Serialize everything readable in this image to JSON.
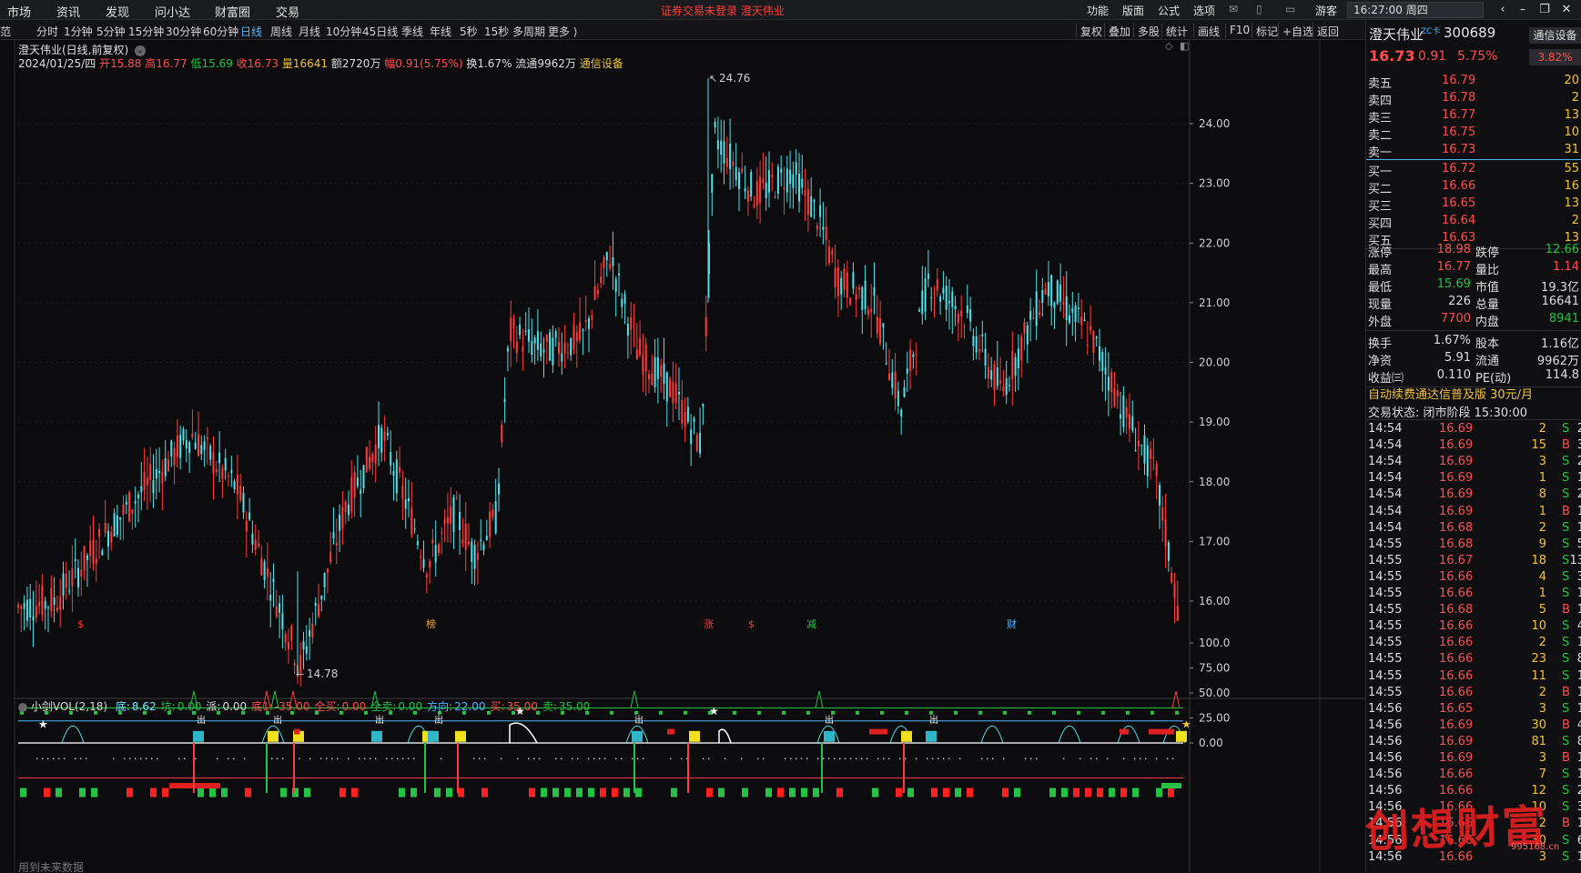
{
  "topbar": {
    "left_menu": [
      "市场",
      "资讯",
      "发现",
      "问小达",
      "财富圈",
      "交易"
    ],
    "warning": "证券交易未登录   澄天伟业",
    "right_menu": [
      "功能",
      "版面",
      "公式",
      "选项"
    ],
    "user": "游客",
    "clock": "16:27:00 周四"
  },
  "periodbar": {
    "cut_label": "范",
    "periods": [
      "分时",
      "1分钟",
      "5分钟",
      "15分钟",
      "30分钟",
      "60分钟",
      "日线",
      "周线",
      "月线",
      "10分钟",
      "45日线",
      "季线",
      "年线",
      "5秒",
      "15秒",
      "多周期",
      "更多 ⟩"
    ],
    "active": "日线",
    "tools": [
      "复权",
      "叠加",
      "多股",
      "统计",
      "画线",
      "F10",
      "标记",
      "+自选",
      "返回"
    ]
  },
  "chart_header": {
    "title": "澄天伟业(日线,前复权)",
    "date": "2024/01/25/四",
    "open_label": "开",
    "open": "15.88",
    "high_label": "高",
    "high": "16.77",
    "low_label": "低",
    "low": "15.69",
    "close_label": "收",
    "close": "16.73",
    "vol_label": "量",
    "vol": "16641",
    "amt_label": "额",
    "amt": "2720万",
    "amp_label": "幅",
    "amp": "0.91(5.75%)",
    "turn_label": "换",
    "turn": "1.67%",
    "float_label": "流通",
    "float": "9962万",
    "sector": "通信设备"
  },
  "price_axis": [
    "24.00",
    "23.00",
    "22.00",
    "21.00",
    "20.00",
    "19.00",
    "18.00",
    "17.00",
    "16.00"
  ],
  "annotations": {
    "max_label": "24.76",
    "min_label": "14.78"
  },
  "markers": [
    {
      "text": "$",
      "color": "#ff3a3a"
    },
    {
      "text": "榜",
      "color": "#f0a030"
    },
    {
      "text": "涨",
      "color": "#ff3a3a"
    },
    {
      "text": "$",
      "color": "#ff3a3a"
    },
    {
      "text": "减",
      "color": "#25c245"
    },
    {
      "text": "财",
      "color": "#4fb6ff"
    }
  ],
  "indicator": {
    "name": "小剑VOL(2,18)",
    "params": [
      {
        "label": "底:",
        "value": "8.62",
        "color": "#7de3ff"
      },
      {
        "label": "坑:",
        "value": "0.00",
        "color": "#25c245"
      },
      {
        "label": "派:",
        "value": "0.00",
        "color": "#dedede"
      },
      {
        "label": "底1:",
        "value": "-35.00",
        "color": "#ff4d4d"
      },
      {
        "label": "全买:",
        "value": "0.00",
        "color": "#ff4d4d"
      },
      {
        "label": "全卖:",
        "value": "0.00",
        "color": "#25c245"
      },
      {
        "label": "方向:",
        "value": "22.00",
        "color": "#4fb6ff"
      },
      {
        "label": "买:",
        "value": "35.00",
        "color": "#ff4d4d"
      },
      {
        "label": "卖:",
        "value": "35.00",
        "color": "#25c245"
      }
    ],
    "axis": [
      "100.0",
      "75.00",
      "50.00",
      "25.00",
      "0.00"
    ],
    "signal_label": "出"
  },
  "quote": {
    "name": "澄天伟业",
    "zc_tag": "ZC卡",
    "code": "300689",
    "industry": "通信设备",
    "price": "16.73",
    "change": "0.91",
    "pct": "5.75%",
    "weibi": "3.82%",
    "asks": [
      {
        "label": "卖五",
        "price": "16.79",
        "vol": "20"
      },
      {
        "label": "卖四",
        "price": "16.78",
        "vol": "2"
      },
      {
        "label": "卖三",
        "price": "16.77",
        "vol": "13"
      },
      {
        "label": "卖二",
        "price": "16.75",
        "vol": "10"
      },
      {
        "label": "卖一",
        "price": "16.73",
        "vol": "31"
      }
    ],
    "bids": [
      {
        "label": "买一",
        "price": "16.72",
        "vol": "55"
      },
      {
        "label": "买二",
        "price": "16.66",
        "vol": "16"
      },
      {
        "label": "买三",
        "price": "16.65",
        "vol": "13"
      },
      {
        "label": "买四",
        "price": "16.64",
        "vol": "2"
      },
      {
        "label": "买五",
        "price": "16.63",
        "vol": "13"
      }
    ],
    "stats1": [
      {
        "l1": "涨停",
        "v1": "18.98",
        "c1": "#ff4d4d",
        "l2": "跌停",
        "v2": "12.66",
        "c2": "#25c245"
      },
      {
        "l1": "最高",
        "v1": "16.77",
        "c1": "#ff4d4d",
        "l2": "量比",
        "v2": "1.14",
        "c2": "#ff4d4d"
      },
      {
        "l1": "最低",
        "v1": "15.69",
        "c1": "#25c245",
        "l2": "市值",
        "v2": "19.3亿",
        "c2": "#dedede"
      },
      {
        "l1": "现量",
        "v1": "226",
        "c1": "#dedede",
        "l2": "总量",
        "v2": "16641",
        "c2": "#dedede"
      },
      {
        "l1": "外盘",
        "v1": "7700",
        "c1": "#ff4d4d",
        "l2": "内盘",
        "v2": "8941",
        "c2": "#25c245"
      }
    ],
    "stats2": [
      {
        "l1": "换手",
        "v1": "1.67%",
        "c1": "#dedede",
        "l2": "股本",
        "v2": "1.16亿",
        "c2": "#dedede"
      },
      {
        "l1": "净资",
        "v1": "5.91",
        "c1": "#dedede",
        "l2": "流通",
        "v2": "9962万",
        "c2": "#dedede"
      },
      {
        "l1": "收益㈢",
        "v1": "0.110",
        "c1": "#dedede",
        "l2": "PE(动)",
        "v2": "114.8",
        "c2": "#dedede"
      }
    ],
    "promo": "自动续费通达信普及版  30元/月",
    "trade_state": "交易状态: 闭市阶段 15:30:00"
  },
  "ticks": [
    {
      "t": "14:54",
      "p": "16.69",
      "v": "2",
      "bs": "S",
      "n": "2"
    },
    {
      "t": "14:54",
      "p": "16.69",
      "v": "15",
      "bs": "B",
      "n": "3"
    },
    {
      "t": "14:54",
      "p": "16.69",
      "v": "3",
      "bs": "S",
      "n": "2"
    },
    {
      "t": "14:54",
      "p": "16.69",
      "v": "1",
      "bs": "S",
      "n": "1"
    },
    {
      "t": "14:54",
      "p": "16.69",
      "v": "8",
      "bs": "S",
      "n": "2"
    },
    {
      "t": "14:54",
      "p": "16.69",
      "v": "1",
      "bs": "B",
      "n": "1"
    },
    {
      "t": "14:54",
      "p": "16.68",
      "v": "2",
      "bs": "S",
      "n": "1"
    },
    {
      "t": "14:55",
      "p": "16.68",
      "v": "9",
      "bs": "S",
      "n": "5"
    },
    {
      "t": "14:55",
      "p": "16.67",
      "v": "18",
      "bs": "S",
      "n": "13"
    },
    {
      "t": "14:55",
      "p": "16.66",
      "v": "4",
      "bs": "S",
      "n": "3"
    },
    {
      "t": "14:55",
      "p": "16.66",
      "v": "1",
      "bs": "S",
      "n": "1"
    },
    {
      "t": "14:55",
      "p": "16.68",
      "v": "5",
      "bs": "B",
      "n": "1"
    },
    {
      "t": "14:55",
      "p": "16.66",
      "v": "10",
      "bs": "S",
      "n": "4"
    },
    {
      "t": "14:55",
      "p": "16.66",
      "v": "2",
      "bs": "S",
      "n": "1"
    },
    {
      "t": "14:55",
      "p": "16.66",
      "v": "23",
      "bs": "S",
      "n": "8"
    },
    {
      "t": "14:55",
      "p": "16.66",
      "v": "11",
      "bs": "S",
      "n": "1"
    },
    {
      "t": "14:55",
      "p": "16.66",
      "v": "2",
      "bs": "B",
      "n": "1"
    },
    {
      "t": "14:56",
      "p": "16.65",
      "v": "3",
      "bs": "S",
      "n": "1"
    },
    {
      "t": "14:56",
      "p": "16.69",
      "v": "30",
      "bs": "B",
      "n": "4"
    },
    {
      "t": "14:56",
      "p": "16.69",
      "v": "81",
      "bs": "S",
      "n": "8"
    },
    {
      "t": "14:56",
      "p": "16.69",
      "v": "3",
      "bs": "B",
      "n": "1"
    },
    {
      "t": "14:56",
      "p": "16.66",
      "v": "7",
      "bs": "S",
      "n": "1"
    },
    {
      "t": "14:56",
      "p": "16.66",
      "v": "12",
      "bs": "S",
      "n": "2"
    },
    {
      "t": "14:56",
      "p": "16.66",
      "v": "10",
      "bs": "S",
      "n": "3"
    },
    {
      "t": "14:56",
      "p": "16.66",
      "v": "2",
      "bs": "B",
      "n": "1"
    },
    {
      "t": "14:56",
      "p": "16.66",
      "v": "30",
      "bs": "S",
      "n": "6"
    },
    {
      "t": "14:56",
      "p": "16.66",
      "v": "3",
      "bs": "S",
      "n": "1"
    }
  ],
  "watermark": {
    "text": "创想财富",
    "url": "995168.cn"
  },
  "bottom_left": "用到未来数据"
}
